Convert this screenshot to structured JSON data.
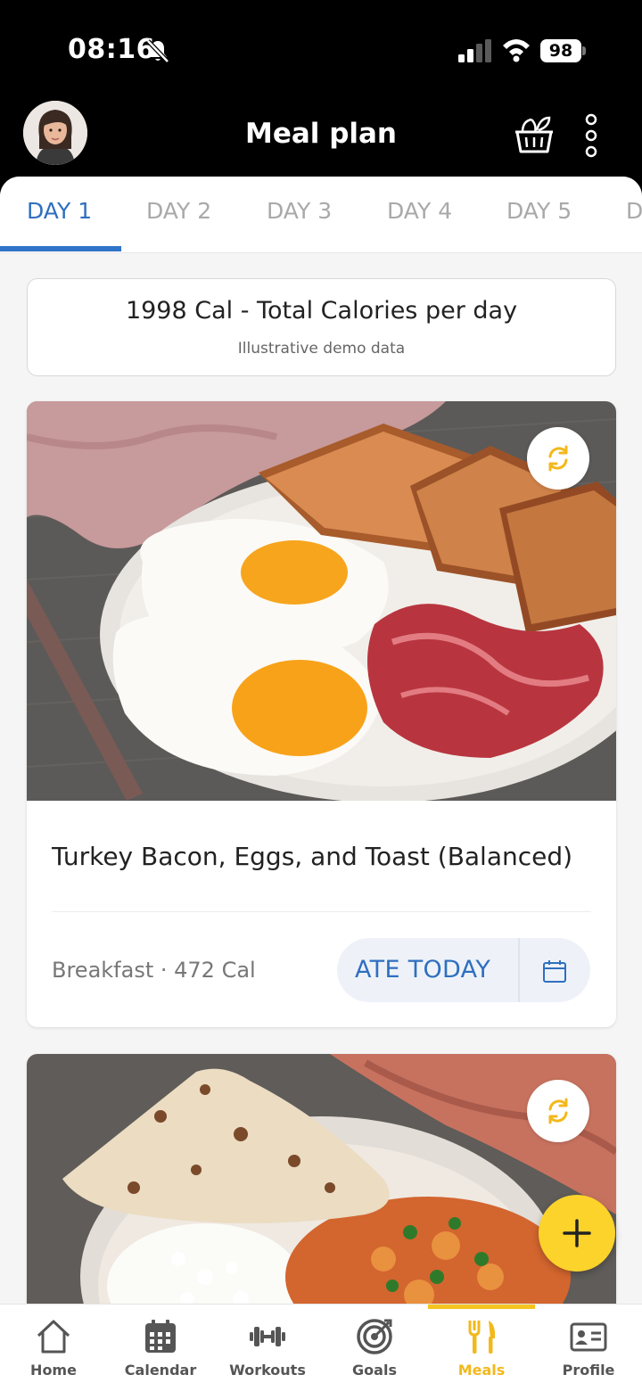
{
  "status_bar": {
    "time": "08:16",
    "battery": "98"
  },
  "header": {
    "title": "Meal plan"
  },
  "tabs": [
    {
      "label": "DAY 1",
      "active": true
    },
    {
      "label": "DAY 2",
      "active": false
    },
    {
      "label": "DAY 3",
      "active": false
    },
    {
      "label": "DAY 4",
      "active": false
    },
    {
      "label": "DAY 5",
      "active": false
    },
    {
      "label": "D",
      "active": false
    }
  ],
  "summary": {
    "total": "1998 Cal - Total Calories per day",
    "note": "Illustrative demo data"
  },
  "meals": [
    {
      "name": "Turkey Bacon, Eggs, and Toast (Balanced)",
      "meta": "Breakfast · 472 Cal",
      "ate_label": "ATE TODAY"
    }
  ],
  "nav": [
    {
      "label": "Home",
      "icon": "home-icon"
    },
    {
      "label": "Calendar",
      "icon": "calendar-icon"
    },
    {
      "label": "Workouts",
      "icon": "dumbbell-icon"
    },
    {
      "label": "Goals",
      "icon": "target-icon"
    },
    {
      "label": "Meals",
      "icon": "fork-knife-icon",
      "active": true
    },
    {
      "label": "Profile",
      "icon": "id-card-icon"
    }
  ],
  "colors": {
    "accent_blue": "#2f6fbf",
    "accent_yellow": "#fcd32b",
    "swap_icon": "#f2b81c"
  }
}
